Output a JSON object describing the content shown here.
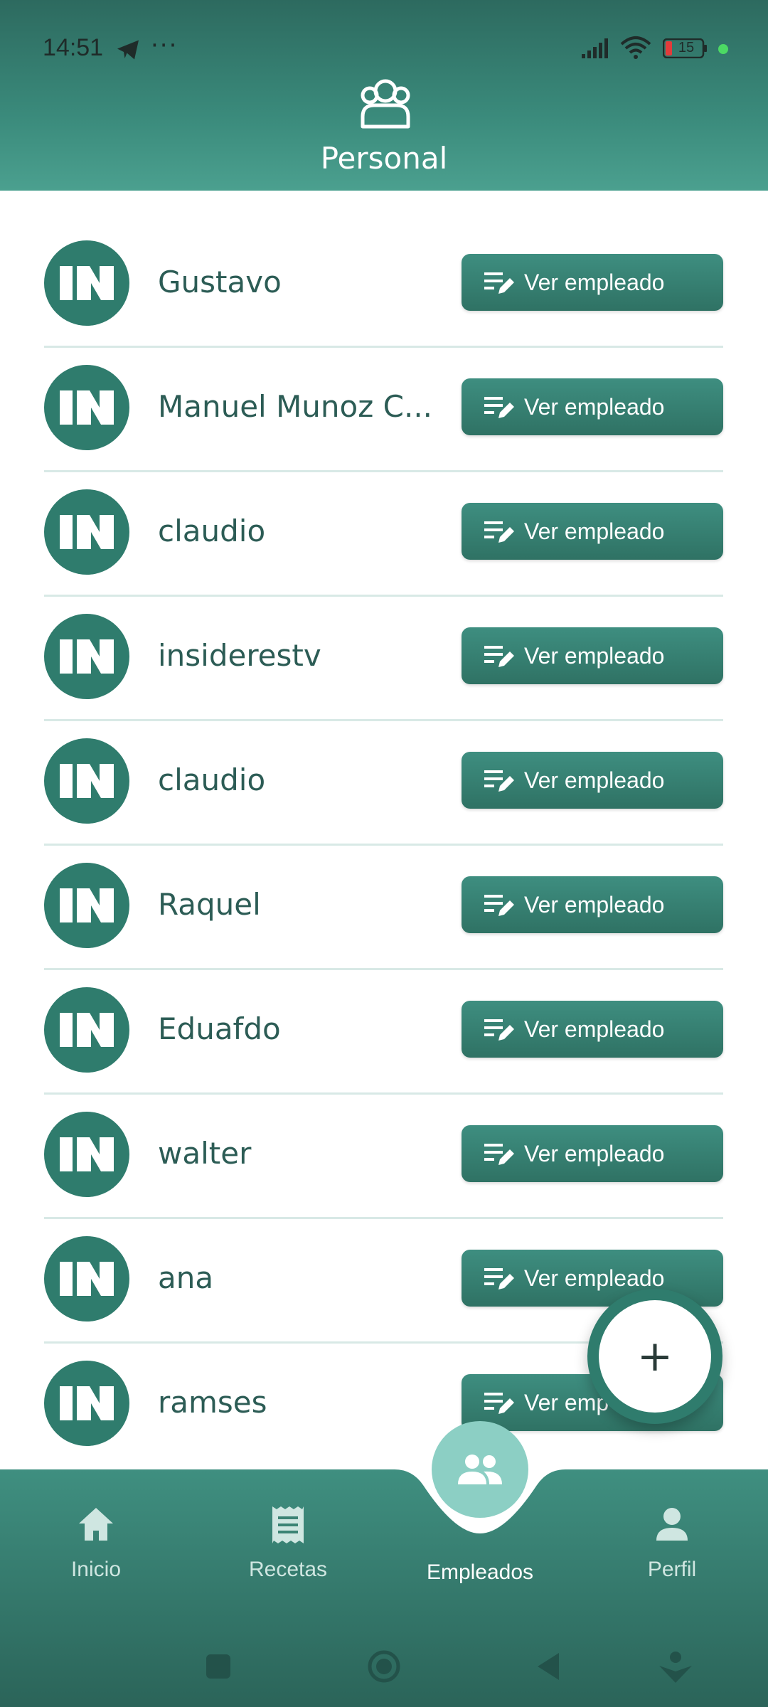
{
  "status_bar": {
    "time": "14:51",
    "battery": "15",
    "icons": [
      "telegram-icon",
      "more-dots-icon",
      "signal-icon",
      "wifi-icon",
      "battery-icon"
    ]
  },
  "header": {
    "title": "Personal",
    "icon": "people-group-icon"
  },
  "employees": [
    {
      "name": "Gustavo",
      "button": "Ver empleado"
    },
    {
      "name": "Manuel Munoz C...",
      "button": "Ver empleado"
    },
    {
      "name": "claudio",
      "button": "Ver empleado"
    },
    {
      "name": "insiderestv",
      "button": "Ver empleado"
    },
    {
      "name": "claudio",
      "button": "Ver empleado"
    },
    {
      "name": "Raquel",
      "button": "Ver empleado"
    },
    {
      "name": "Eduafdo",
      "button": "Ver empleado"
    },
    {
      "name": "walter",
      "button": "Ver empleado"
    },
    {
      "name": "ana",
      "button": "Ver empleado"
    },
    {
      "name": "ramses",
      "button": "Ver emp"
    }
  ],
  "fab": {
    "symbol": "+"
  },
  "nav": {
    "items": [
      {
        "label": "Inicio",
        "icon": "home-icon"
      },
      {
        "label": "Recetas",
        "icon": "receipt-icon"
      },
      {
        "label": "Empleados",
        "icon": "people-icon",
        "active": true
      },
      {
        "label": "Perfil",
        "icon": "person-icon"
      }
    ]
  },
  "colors": {
    "primary": "#2f7c6d",
    "header_top": "#2d6a5f",
    "header_bottom": "#4ba08f",
    "nav_active_bubble": "#8ccfc4",
    "divider": "#d8e9e6"
  }
}
